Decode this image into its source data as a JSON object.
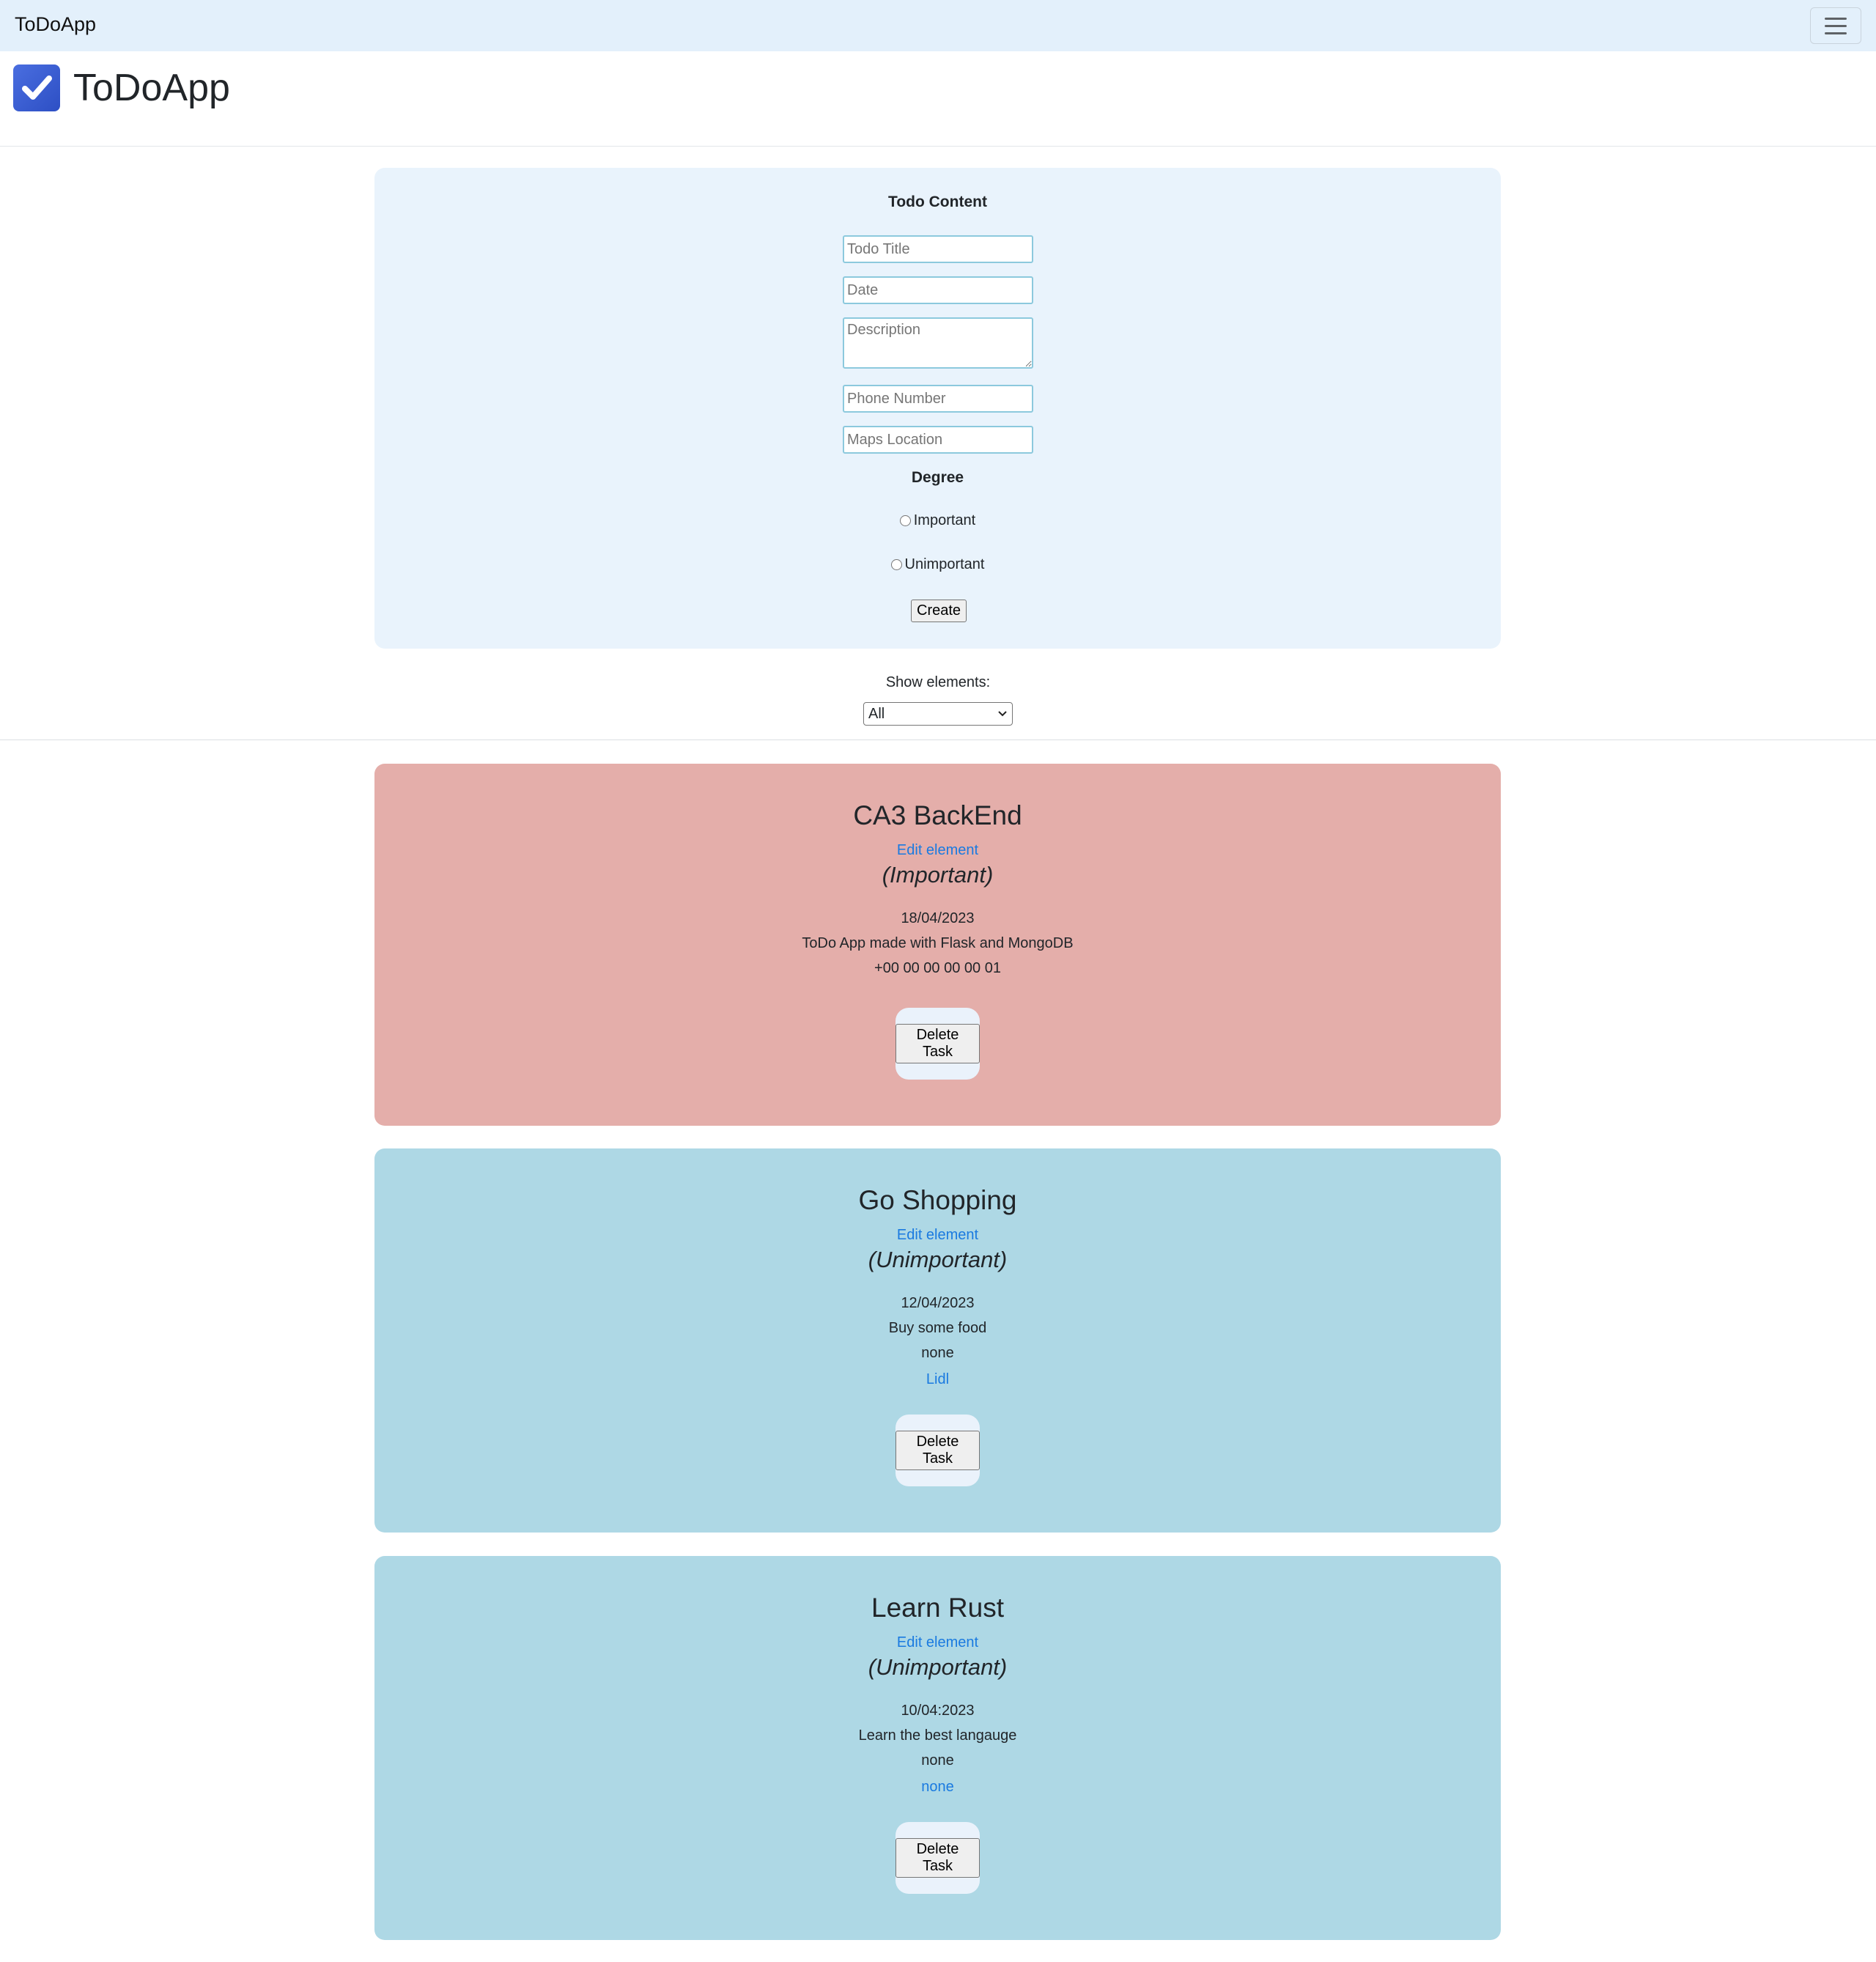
{
  "navbar": {
    "brand": "ToDoApp"
  },
  "header": {
    "title": "ToDoApp"
  },
  "form": {
    "title": "Todo Content",
    "todo_title_placeholder": "Todo Title",
    "date_placeholder": "Date",
    "description_placeholder": "Description",
    "phone_placeholder": "Phone Number",
    "maps_placeholder": "Maps Location",
    "degree_label": "Degree",
    "radio_important": "Important",
    "radio_unimportant": "Unimportant",
    "create_label": "Create"
  },
  "filter": {
    "label": "Show elements:",
    "selected": "All"
  },
  "tasks": [
    {
      "title": "CA3 BackEnd",
      "edit_label": "Edit element",
      "degree": "(Important)",
      "date": "18/04/2023",
      "description": "ToDo App made with Flask and MongoDB",
      "phone": "+00 00 00 00 00 01",
      "delete_label": "Delete Task",
      "color": "#e4aeaa"
    },
    {
      "title": "Go Shopping",
      "edit_label": "Edit element",
      "degree": "(Unimportant)",
      "date": "12/04/2023",
      "description": "Buy some food",
      "phone": "none",
      "location": "Lidl",
      "delete_label": "Delete Task",
      "color": "#aed8e5"
    },
    {
      "title": "Learn Rust",
      "edit_label": "Edit element",
      "degree": "(Unimportant)",
      "date": "10/04:2023",
      "description": "Learn the best langauge",
      "phone": "none",
      "location": "none",
      "delete_label": "Delete Task",
      "color": "#aed8e5"
    }
  ]
}
